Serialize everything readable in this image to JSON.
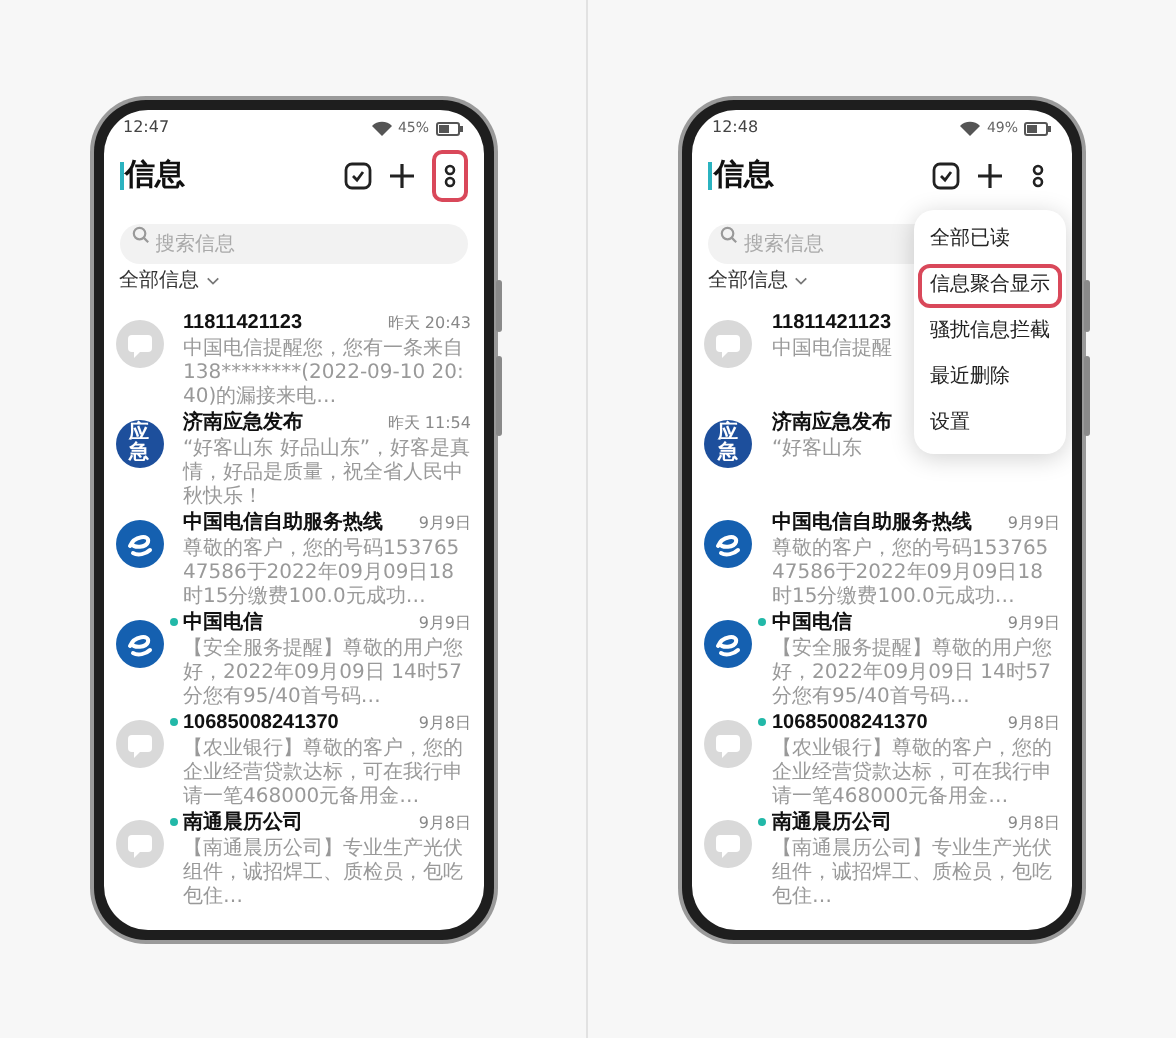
{
  "phones": [
    {
      "status": {
        "time": "12:47",
        "battery": "45%"
      },
      "title": "信息",
      "more_highlighted": true,
      "search": {
        "placeholder": "搜索信息"
      },
      "filter": "全部信息",
      "conversations": [
        {
          "name": "11811421123",
          "time": "昨天 20:43",
          "preview": "中国电信提醒您，您有一条来自138********(2022-09-10 20:40)的漏接来电…",
          "unread": false,
          "avatar": {
            "kind": "generic"
          }
        },
        {
          "name": "济南应急发布",
          "time": "昨天 11:54",
          "preview": "“好客山东 好品山东”，好客是真情，好品是质量，祝全省人民中秋快乐！",
          "unread": false,
          "avatar": {
            "kind": "badge",
            "text": "应急"
          }
        },
        {
          "name": "中国电信自助服务热线",
          "time": "9月9日",
          "preview": "尊敬的客户，您的号码15376547586于2022年09月09日18时15分缴费100.0元成功…",
          "unread": false,
          "avatar": {
            "kind": "telecom"
          }
        },
        {
          "name": "中国电信",
          "time": "9月9日",
          "preview": "【安全服务提醒】尊敬的用户您好，2022年09月09日 14时57分您有95/40首号码…",
          "unread": true,
          "avatar": {
            "kind": "telecom"
          }
        },
        {
          "name": "10685008241370",
          "time": "9月8日",
          "preview": "【农业银行】尊敬的客户，您的企业经营贷款达标，可在我行申请一笔468000元备用金…",
          "unread": true,
          "avatar": {
            "kind": "generic"
          }
        },
        {
          "name": "南通晨历公司",
          "time": "9月8日",
          "preview": "【南通晨历公司】专业生产光伏组件，诚招焊工、质检员，包吃包住…",
          "unread": true,
          "avatar": {
            "kind": "generic"
          }
        }
      ]
    },
    {
      "status": {
        "time": "12:48",
        "battery": "49%"
      },
      "title": "信息",
      "more_highlighted": false,
      "search": {
        "placeholder": "搜索信息"
      },
      "filter": "全部信息",
      "conversations": [
        {
          "name": "11811421123",
          "preview": "中国电信提醒",
          "unread": false,
          "avatar": {
            "kind": "generic"
          }
        },
        {
          "name": "济南应急发布",
          "preview": "“好客山东",
          "unread": false,
          "avatar": {
            "kind": "badge",
            "text": "应急"
          }
        },
        {
          "name": "中国电信自助服务热线",
          "time": "9月9日",
          "preview": "尊敬的客户，您的号码15376547586于2022年09月09日18时15分缴费100.0元成功…",
          "unread": false,
          "avatar": {
            "kind": "telecom"
          }
        },
        {
          "name": "中国电信",
          "time": "9月9日",
          "preview": "【安全服务提醒】尊敬的用户您好，2022年09月09日 14时57分您有95/40首号码…",
          "unread": true,
          "avatar": {
            "kind": "telecom"
          }
        },
        {
          "name": "10685008241370",
          "time": "9月8日",
          "preview": "【农业银行】尊敬的客户，您的企业经营贷款达标，可在我行申请一笔468000元备用金…",
          "unread": true,
          "avatar": {
            "kind": "generic"
          }
        },
        {
          "name": "南通晨历公司",
          "time": "9月8日",
          "preview": "【南通晨历公司】专业生产光伏组件，诚招焊工、质检员，包吃包住…",
          "unread": true,
          "avatar": {
            "kind": "generic"
          }
        }
      ],
      "menu": [
        {
          "label": "全部已读",
          "highlighted": false
        },
        {
          "label": "信息聚合显示",
          "highlighted": true
        },
        {
          "label": "骚扰信息拦截",
          "highlighted": false
        },
        {
          "label": "最近删除",
          "highlighted": false
        },
        {
          "label": "设置",
          "highlighted": false
        }
      ]
    }
  ]
}
